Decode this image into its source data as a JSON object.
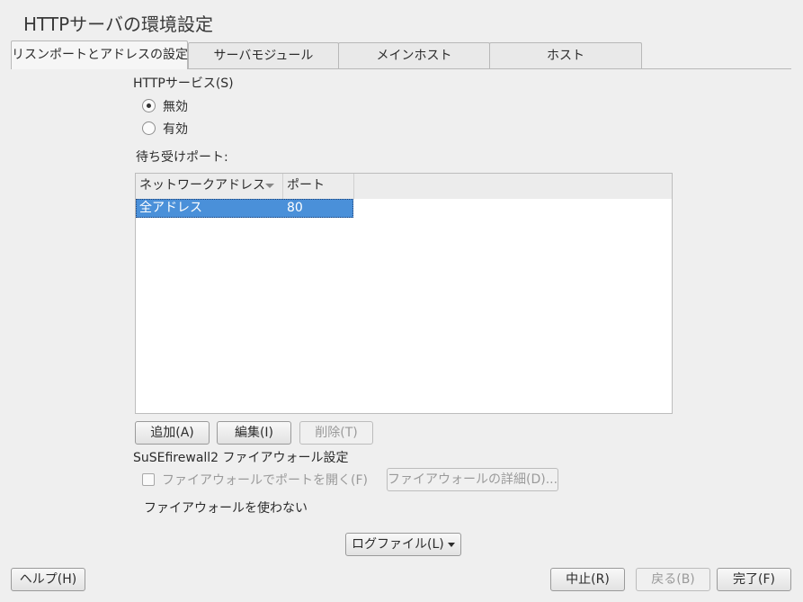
{
  "window": {
    "title": "HTTPサーバの環境設定"
  },
  "tabs": [
    {
      "label": "リスンポートとアドレスの設定",
      "active": true
    },
    {
      "label": "サーバモジュール",
      "active": false
    },
    {
      "label": "メインホスト",
      "active": false
    },
    {
      "label": "ホスト",
      "active": false
    }
  ],
  "http_service": {
    "label": "HTTPサービス(S)",
    "options": [
      {
        "label": "無効",
        "selected": true
      },
      {
        "label": "有効",
        "selected": false
      }
    ]
  },
  "listen_ports": {
    "label": "待ち受けポート:",
    "columns": [
      "ネットワークアドレス",
      "ポート"
    ],
    "rows": [
      {
        "address": "全アドレス",
        "port": "80",
        "selected": true
      }
    ],
    "buttons": {
      "add": "追加(A)",
      "edit": "編集(I)",
      "delete": "削除(T)"
    }
  },
  "firewall": {
    "heading": "SuSEfirewall2 ファイアウォール設定",
    "open_port_label": "ファイアウォールでポートを開く(F)",
    "details_button": "ファイアウォールの詳細(D)...",
    "status_text": "ファイアウォールを使わない"
  },
  "log_files_button": "ログファイル(L)",
  "footer": {
    "help": "ヘルプ(H)",
    "abort": "中止(R)",
    "back": "戻る(B)",
    "finish": "完了(F)"
  }
}
